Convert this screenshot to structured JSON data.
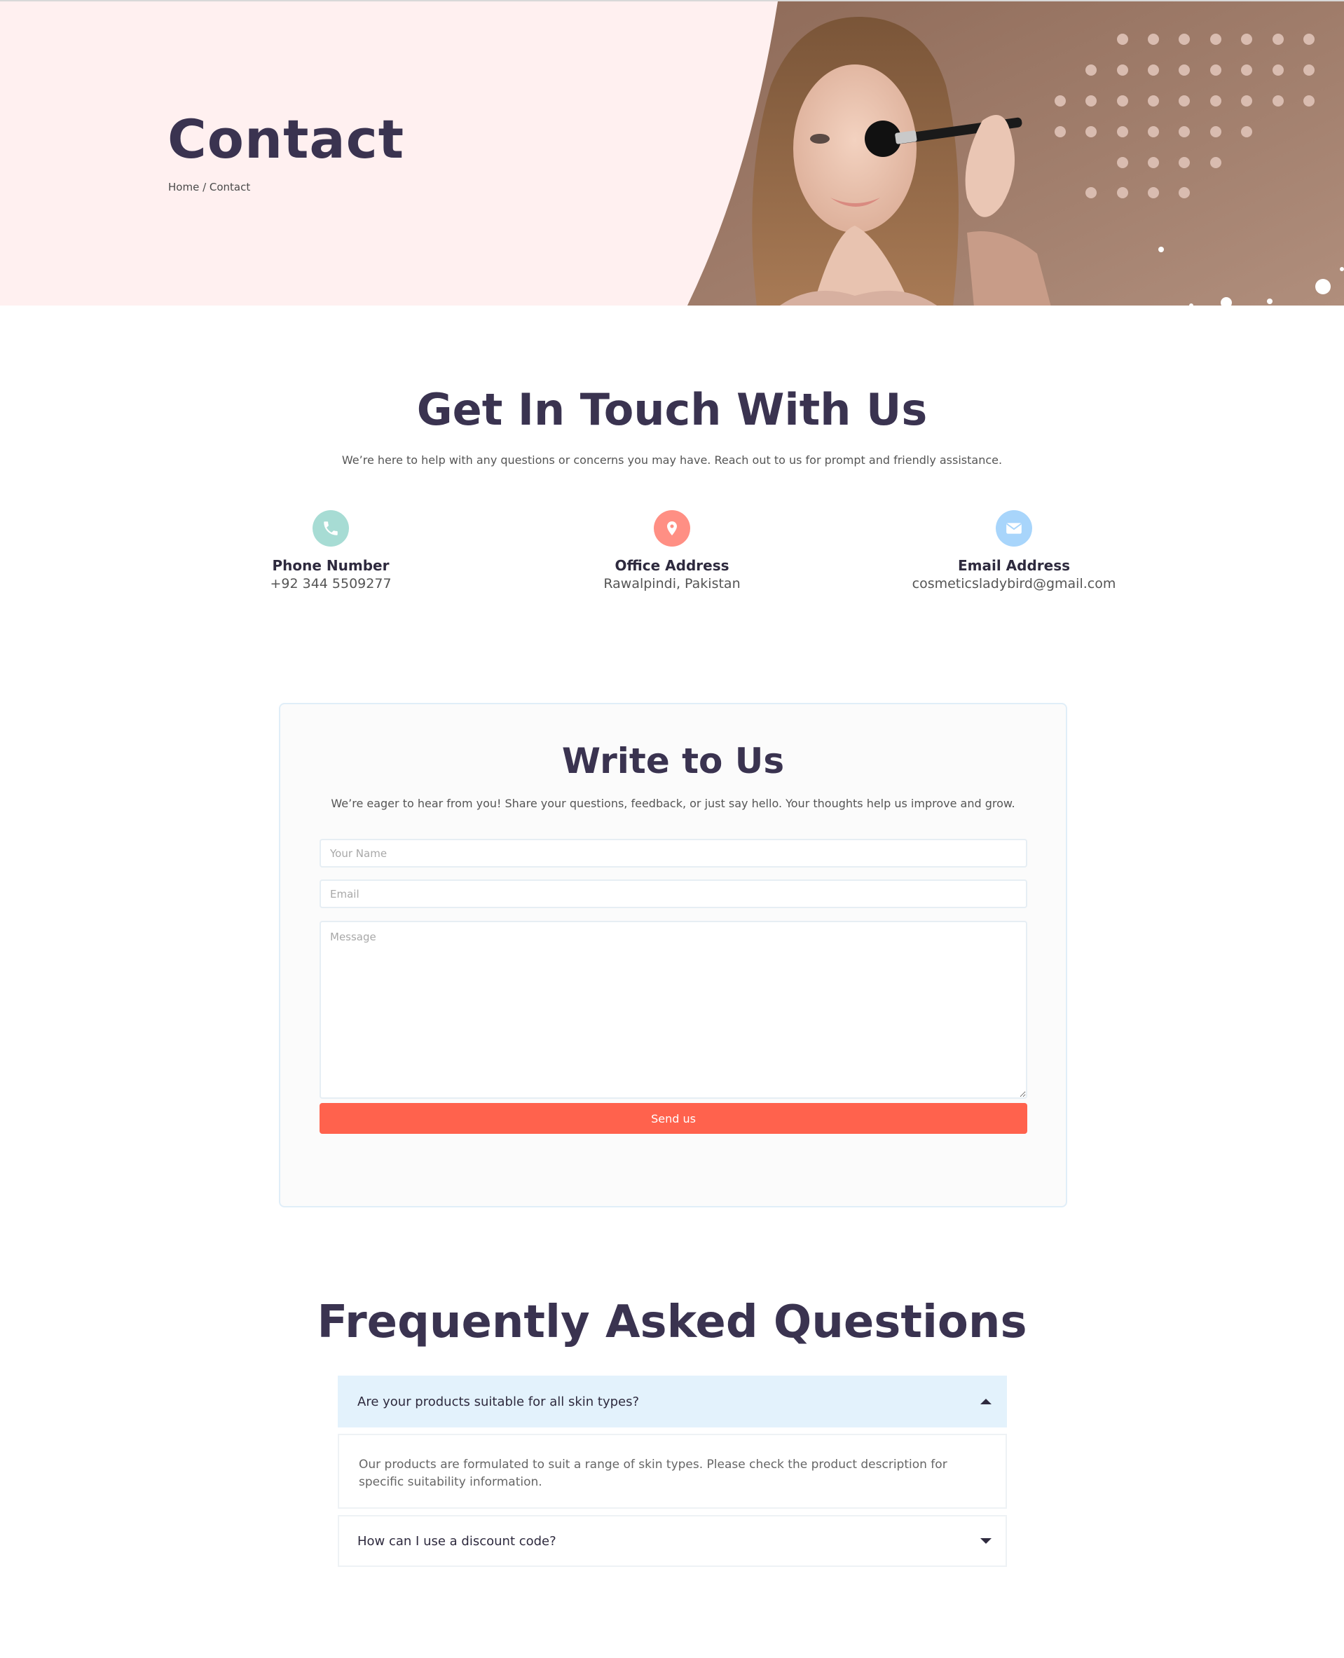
{
  "hero": {
    "title": "Contact",
    "breadcrumb": "Home / Contact"
  },
  "touch": {
    "title": "Get In Touch With Us",
    "subtitle": "We’re here to help with any questions or concerns you may have. Reach out to us for prompt and friendly assistance.",
    "cards": [
      {
        "icon": "phone-icon",
        "color": "#a7dcd4",
        "label": "Phone Number",
        "value": "+92 344 5509277"
      },
      {
        "icon": "location-pin-icon",
        "color": "#ff8f84",
        "label": "Office Address",
        "value": "Rawalpindi, Pakistan"
      },
      {
        "icon": "envelope-icon",
        "color": "#a8d5fb",
        "label": "Email Address",
        "value": "cosmeticsladybird@gmail.com"
      }
    ]
  },
  "form": {
    "title": "Write to Us",
    "subtitle": "We’re eager to hear from you! Share your questions, feedback, or just say hello. Your thoughts help us improve and grow.",
    "name_placeholder": "Your Name",
    "email_placeholder": "Email",
    "message_placeholder": "Message",
    "submit_label": "Send us",
    "accent": "#ff624d"
  },
  "faq": {
    "title": "Frequently Asked Questions",
    "items": [
      {
        "question": "Are your products suitable for all skin types?",
        "answer": "Our products are formulated to suit a range of skin types. Please check the product description for specific suitability information.",
        "expanded": true
      },
      {
        "question": "How can I use a discount code?",
        "expanded": false
      }
    ]
  }
}
